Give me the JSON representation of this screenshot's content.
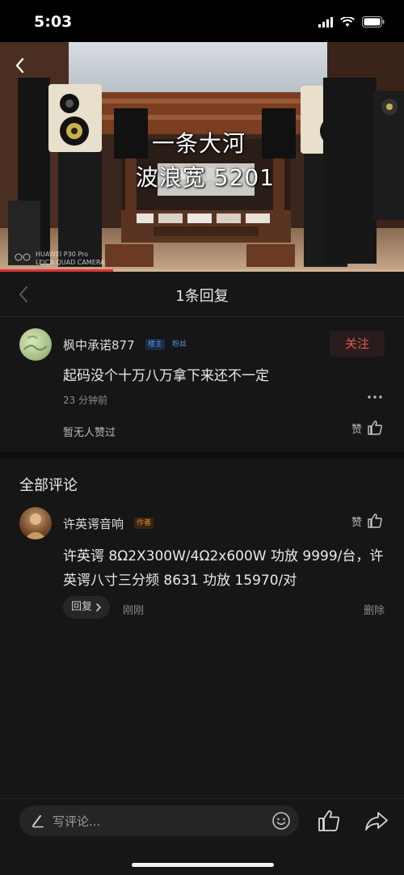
{
  "status_bar": {
    "time": "5:03"
  },
  "video": {
    "caption_line1": "一条大河",
    "caption_line2": "波浪宽 5201",
    "watermark_line1": "HUAWEI P30 Pro",
    "watermark_line2": "LEICA QUAD CAMERA",
    "progress": 0.28
  },
  "reply_header": {
    "title": "1条回复"
  },
  "main_comment": {
    "username": "枫中承诺877",
    "tag_owner": "楼主",
    "tag_fans": "粉丝",
    "follow_label": "关注",
    "text": "起码没个十万八万拿下来还不一定",
    "time": "23 分钟前",
    "no_likes": "暂无人赞过",
    "like_label": "赞"
  },
  "all_comments": {
    "title": "全部评论",
    "items": [
      {
        "username": "许英谔音响",
        "tag_author": "作者",
        "like_label": "赞",
        "text": "许英谔 8Ω2X300W/4Ω2x600W 功放 9999/台，许英谔八寸三分频 8631 功放 15970/对",
        "reply_label": "回复",
        "time": "刚刚",
        "delete_label": "删除"
      }
    ]
  },
  "bottom_bar": {
    "placeholder": "写评论..."
  },
  "colors": {
    "background": "#161616",
    "accent_red": "#e05a55",
    "tag_blue": "#5b8fe0",
    "tag_orange": "#d88c3a"
  },
  "icons": [
    "back-icon",
    "signal-icon",
    "wifi-icon",
    "battery-icon",
    "more-icon",
    "thumb-up-icon",
    "chevron-right-icon",
    "pen-icon",
    "emoji-icon",
    "share-icon"
  ]
}
